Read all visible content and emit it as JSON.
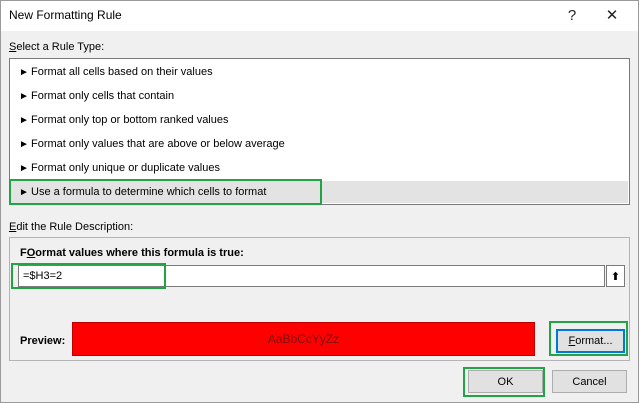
{
  "dialog": {
    "title": "New Formatting Rule",
    "help_label": "?",
    "close_label": "✕"
  },
  "rule_type": {
    "label_underline": "S",
    "label_rest": "elect a Rule Type:",
    "items": [
      {
        "label": "Format all cells based on their values",
        "selected": false
      },
      {
        "label": "Format only cells that contain",
        "selected": false
      },
      {
        "label": "Format only top or bottom ranked values",
        "selected": false
      },
      {
        "label": "Format only values that are above or below average",
        "selected": false
      },
      {
        "label": "Format only unique or duplicate values",
        "selected": false
      },
      {
        "label": "Use a formula to determine which cells to format",
        "selected": true
      }
    ],
    "item_bullet": "►"
  },
  "description": {
    "label_underline": "E",
    "label_rest": "dit the Rule Description:",
    "formula_label_underline": "O",
    "formula_label_rest": "ormat values where this formula is true:",
    "formula_label_first": "F",
    "formula_value": "=$H3=2",
    "collapse_icon": "⬆",
    "preview_label": "Preview:",
    "preview_sample": "AaBbCcYyZz",
    "format_button_underline": "F",
    "format_button_rest": "ormat..."
  },
  "buttons": {
    "ok": "OK",
    "cancel": "Cancel"
  },
  "colors": {
    "preview_fill": "#ff0000",
    "highlight": "#21a346",
    "selected_row": "#e3e3e3",
    "focus_border": "#0078d7"
  }
}
